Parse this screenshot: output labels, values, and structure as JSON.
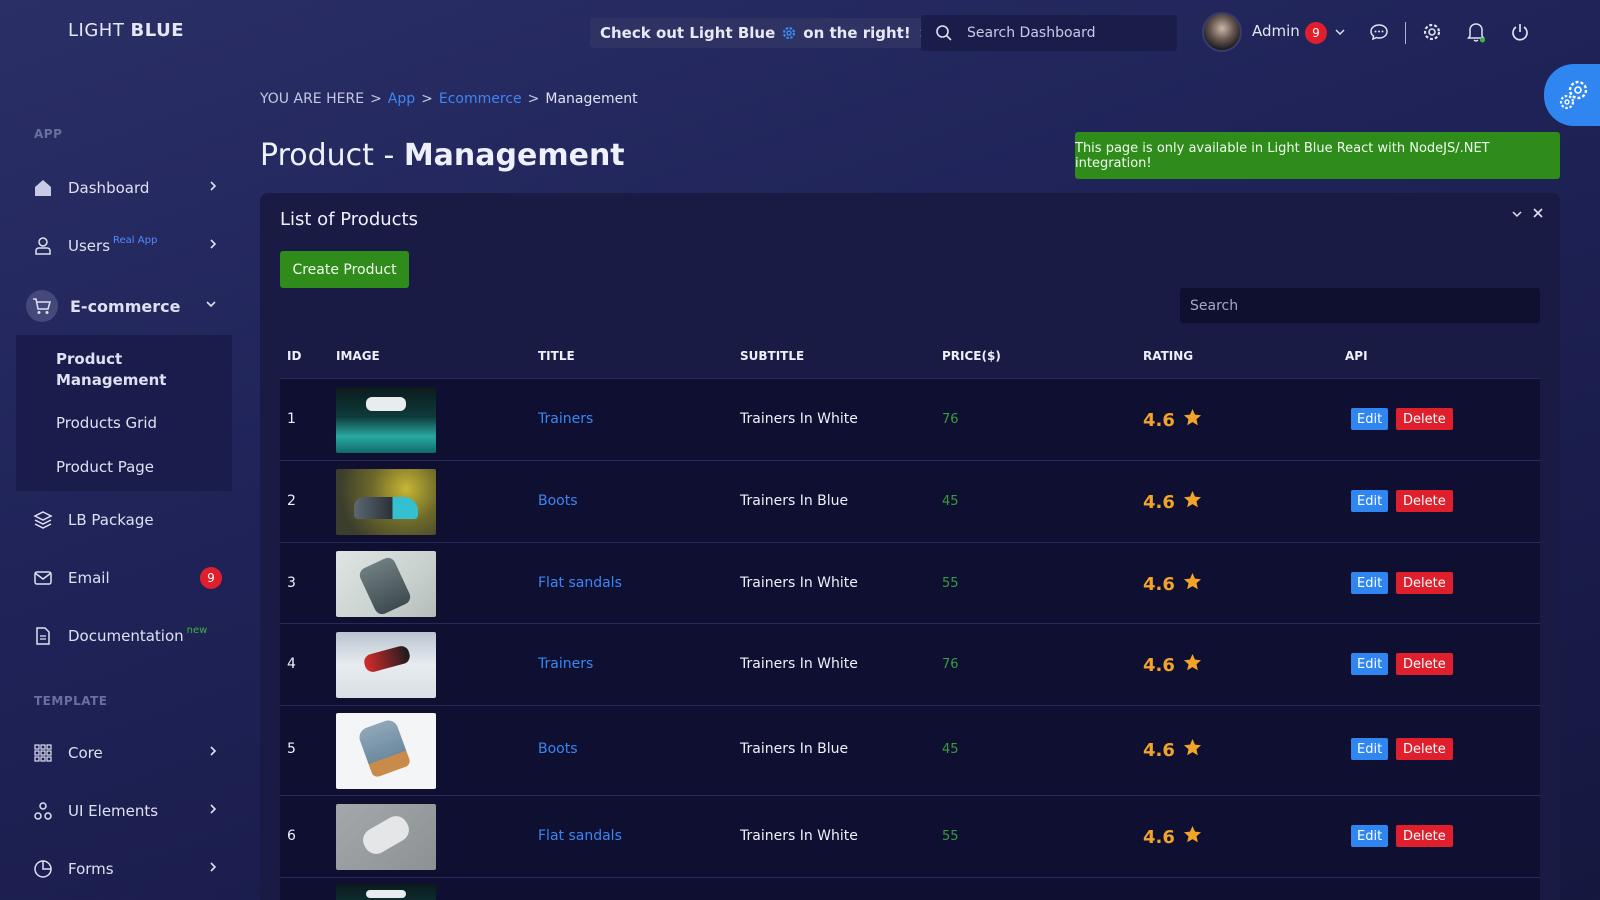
{
  "app": {
    "logo_light": "LIGHT ",
    "logo_bold": "BLUE"
  },
  "topbar": {
    "promo_text_before": "Check out Light Blue",
    "promo_text_after": "on the right!",
    "search_placeholder": "Search Dashboard",
    "user_name": "Admin",
    "user_badge": "9"
  },
  "sidebar": {
    "section_app": "APP",
    "section_template": "TEMPLATE",
    "items": [
      {
        "label": "Dashboard"
      },
      {
        "label": "Users",
        "sup": "Real App"
      },
      {
        "label": "E-commerce"
      },
      {
        "label": "LB Package"
      },
      {
        "label": "Email",
        "badge": "9"
      },
      {
        "label": "Documentation",
        "sup": "new"
      },
      {
        "label": "Core"
      },
      {
        "label": "UI Elements"
      },
      {
        "label": "Forms"
      }
    ],
    "ecommerce_sub": [
      {
        "label": "Product Management"
      },
      {
        "label": "Products Grid"
      },
      {
        "label": "Product Page"
      }
    ]
  },
  "breadcrumb": {
    "prefix": "YOU ARE HERE",
    "items": [
      "App",
      "Ecommerce",
      "Management"
    ]
  },
  "page": {
    "title_light": "Product - ",
    "title_bold": "Management"
  },
  "alert": {
    "text": "This page is only available in Light Blue React with NodeJS/.NET integration!"
  },
  "panel": {
    "title": "List of Products",
    "create_label": "Create Product",
    "search_placeholder": "Search",
    "columns": [
      "ID",
      "IMAGE",
      "TITLE",
      "SUBTITLE",
      "PRICE($)",
      "RATING",
      "API"
    ],
    "edit_label": "Edit",
    "delete_label": "Delete",
    "rows": [
      {
        "id": "1",
        "image": "sneakers-floating-teal",
        "title": "Trainers",
        "subtitle": "Trainers In White",
        "price": "76",
        "rating": "4.6"
      },
      {
        "id": "2",
        "image": "sneaker-yellow-bokeh",
        "title": "Boots",
        "subtitle": "Trainers In Blue",
        "price": "45",
        "rating": "4.6"
      },
      {
        "id": "3",
        "image": "boots-grey-legs",
        "title": "Flat sandals",
        "subtitle": "Trainers In White",
        "price": "55",
        "rating": "4.6"
      },
      {
        "id": "4",
        "image": "sneaker-red-hand",
        "title": "Trainers",
        "subtitle": "Trainers In White",
        "price": "76",
        "rating": "4.6"
      },
      {
        "id": "5",
        "image": "boots-blue-suede",
        "title": "Boots",
        "subtitle": "Trainers In Blue",
        "price": "45",
        "rating": "4.6"
      },
      {
        "id": "6",
        "image": "sneakers-white-grey",
        "title": "Flat sandals",
        "subtitle": "Trainers In White",
        "price": "55",
        "rating": "4.6"
      }
    ]
  },
  "colors": {
    "accent": "#2f86f0",
    "success": "#2f8c1a",
    "danger": "#e01f2d",
    "rating": "#f2a42a",
    "link": "#3a86f4"
  }
}
